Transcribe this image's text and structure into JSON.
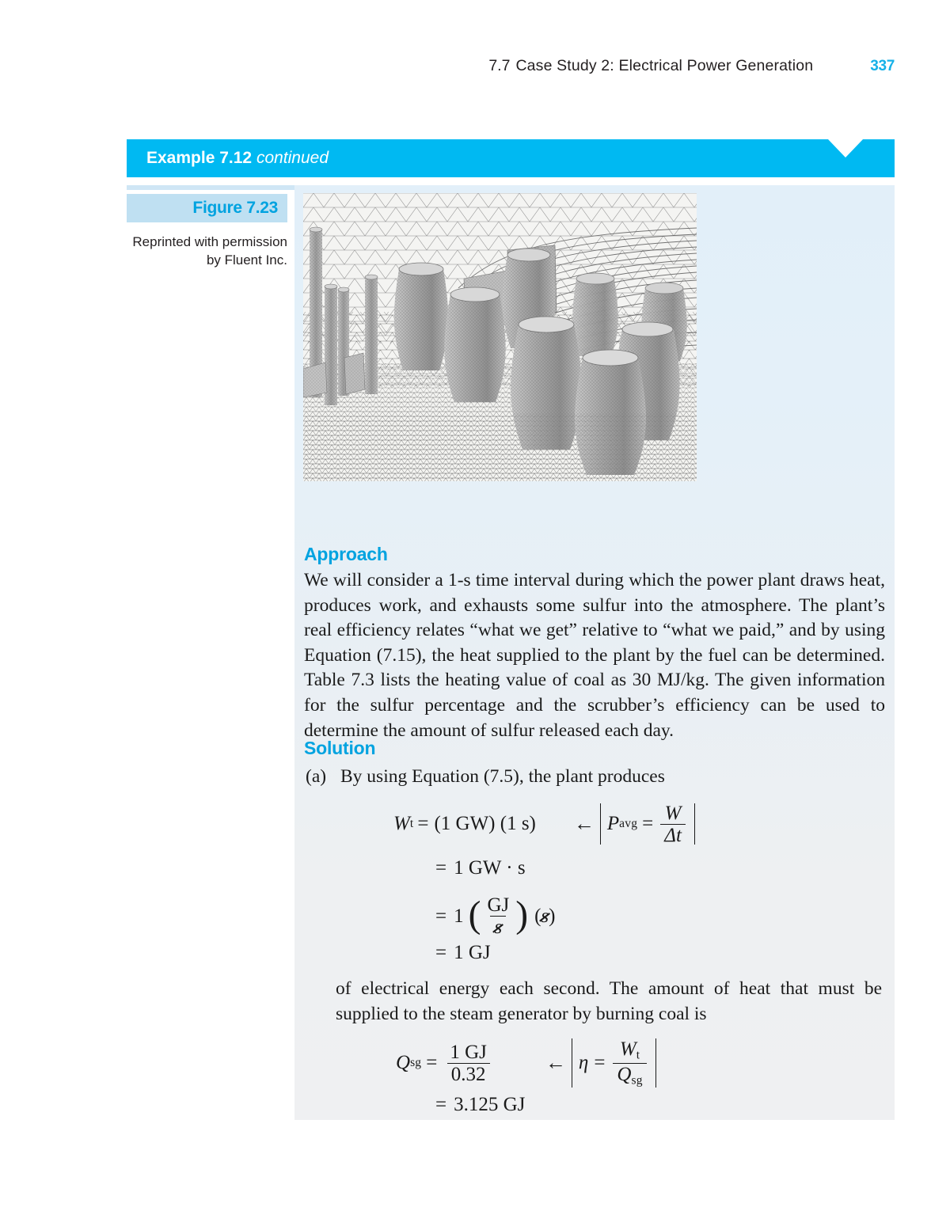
{
  "running_head": {
    "section_number": "7.7",
    "title": "Case Study 2: Electrical Power Generation",
    "page_number": "337",
    "page_number_color": "#16b1e8"
  },
  "example_banner": {
    "label": "Example",
    "number": "7.12",
    "status": "continued",
    "background_color": "#00b9f2",
    "text_color": "#ffffff"
  },
  "figure": {
    "label": "Figure 7.23",
    "label_color": "#00a3e0",
    "label_band_color": "#bfe0f2",
    "credit_line_1": "Reprinted with permission",
    "credit_line_2": "by Fluent Inc.",
    "alt": "Computational fluid dynamics surface mesh of a power plant site showing hyperbolic cooling towers, smokestacks and a triangulated ground plane"
  },
  "approach": {
    "heading": "Approach",
    "body": "We will consider a 1-s time interval during which the power plant draws heat, produces work, and exhausts some sulfur into the atmosphere. The plant’s real efficiency relates “what we get” relative to “what we paid,” and by using Equation (7.15), the heat supplied to the plant by the fuel can be determined. Table 7.3 lists the heating value of coal as 30 MJ/kg. The given information for the sulfur percentage and the scrubber’s efficiency can be used to determine the amount of sulfur released each day."
  },
  "solution": {
    "heading": "Solution",
    "item_a_marker": "(a)",
    "item_a_text": "By using Equation (7.5), the plant produces",
    "paragraph_2": "of electrical energy each second. The amount of heat that must be supplied to the steam generator by burning coal is",
    "equations": {
      "eq1": {
        "lhs_var": "W",
        "lhs_sub": "t",
        "equals": "=",
        "rhs": "(1 GW) (1 s)",
        "note_arrow": "←",
        "note_var": "P",
        "note_sub": "avg",
        "note_equals": "=",
        "note_num": "W",
        "note_den": "Δt"
      },
      "eq2": {
        "equals": "=",
        "value": "1 GW · s"
      },
      "eq3": {
        "equals": "=",
        "coefficient": "1",
        "num": "GJ",
        "den": "s",
        "factor": "s",
        "note": "units s cancel"
      },
      "eq4": {
        "equals": "=",
        "value": "1 GJ"
      },
      "eq5": {
        "lhs_var": "Q",
        "lhs_sub": "sg",
        "equals": "=",
        "num": "1 GJ",
        "den": "0.32",
        "note_arrow": "←",
        "note_var": "η",
        "note_equals": "=",
        "note_num_var": "W",
        "note_num_sub": "t",
        "note_den_var": "Q",
        "note_den_sub": "sg"
      },
      "eq6": {
        "equals": "=",
        "value": "3.125 GJ"
      }
    }
  },
  "panel": {
    "background_top_color": "#e2eff9",
    "background_bottom_color": "#eff0f2"
  }
}
